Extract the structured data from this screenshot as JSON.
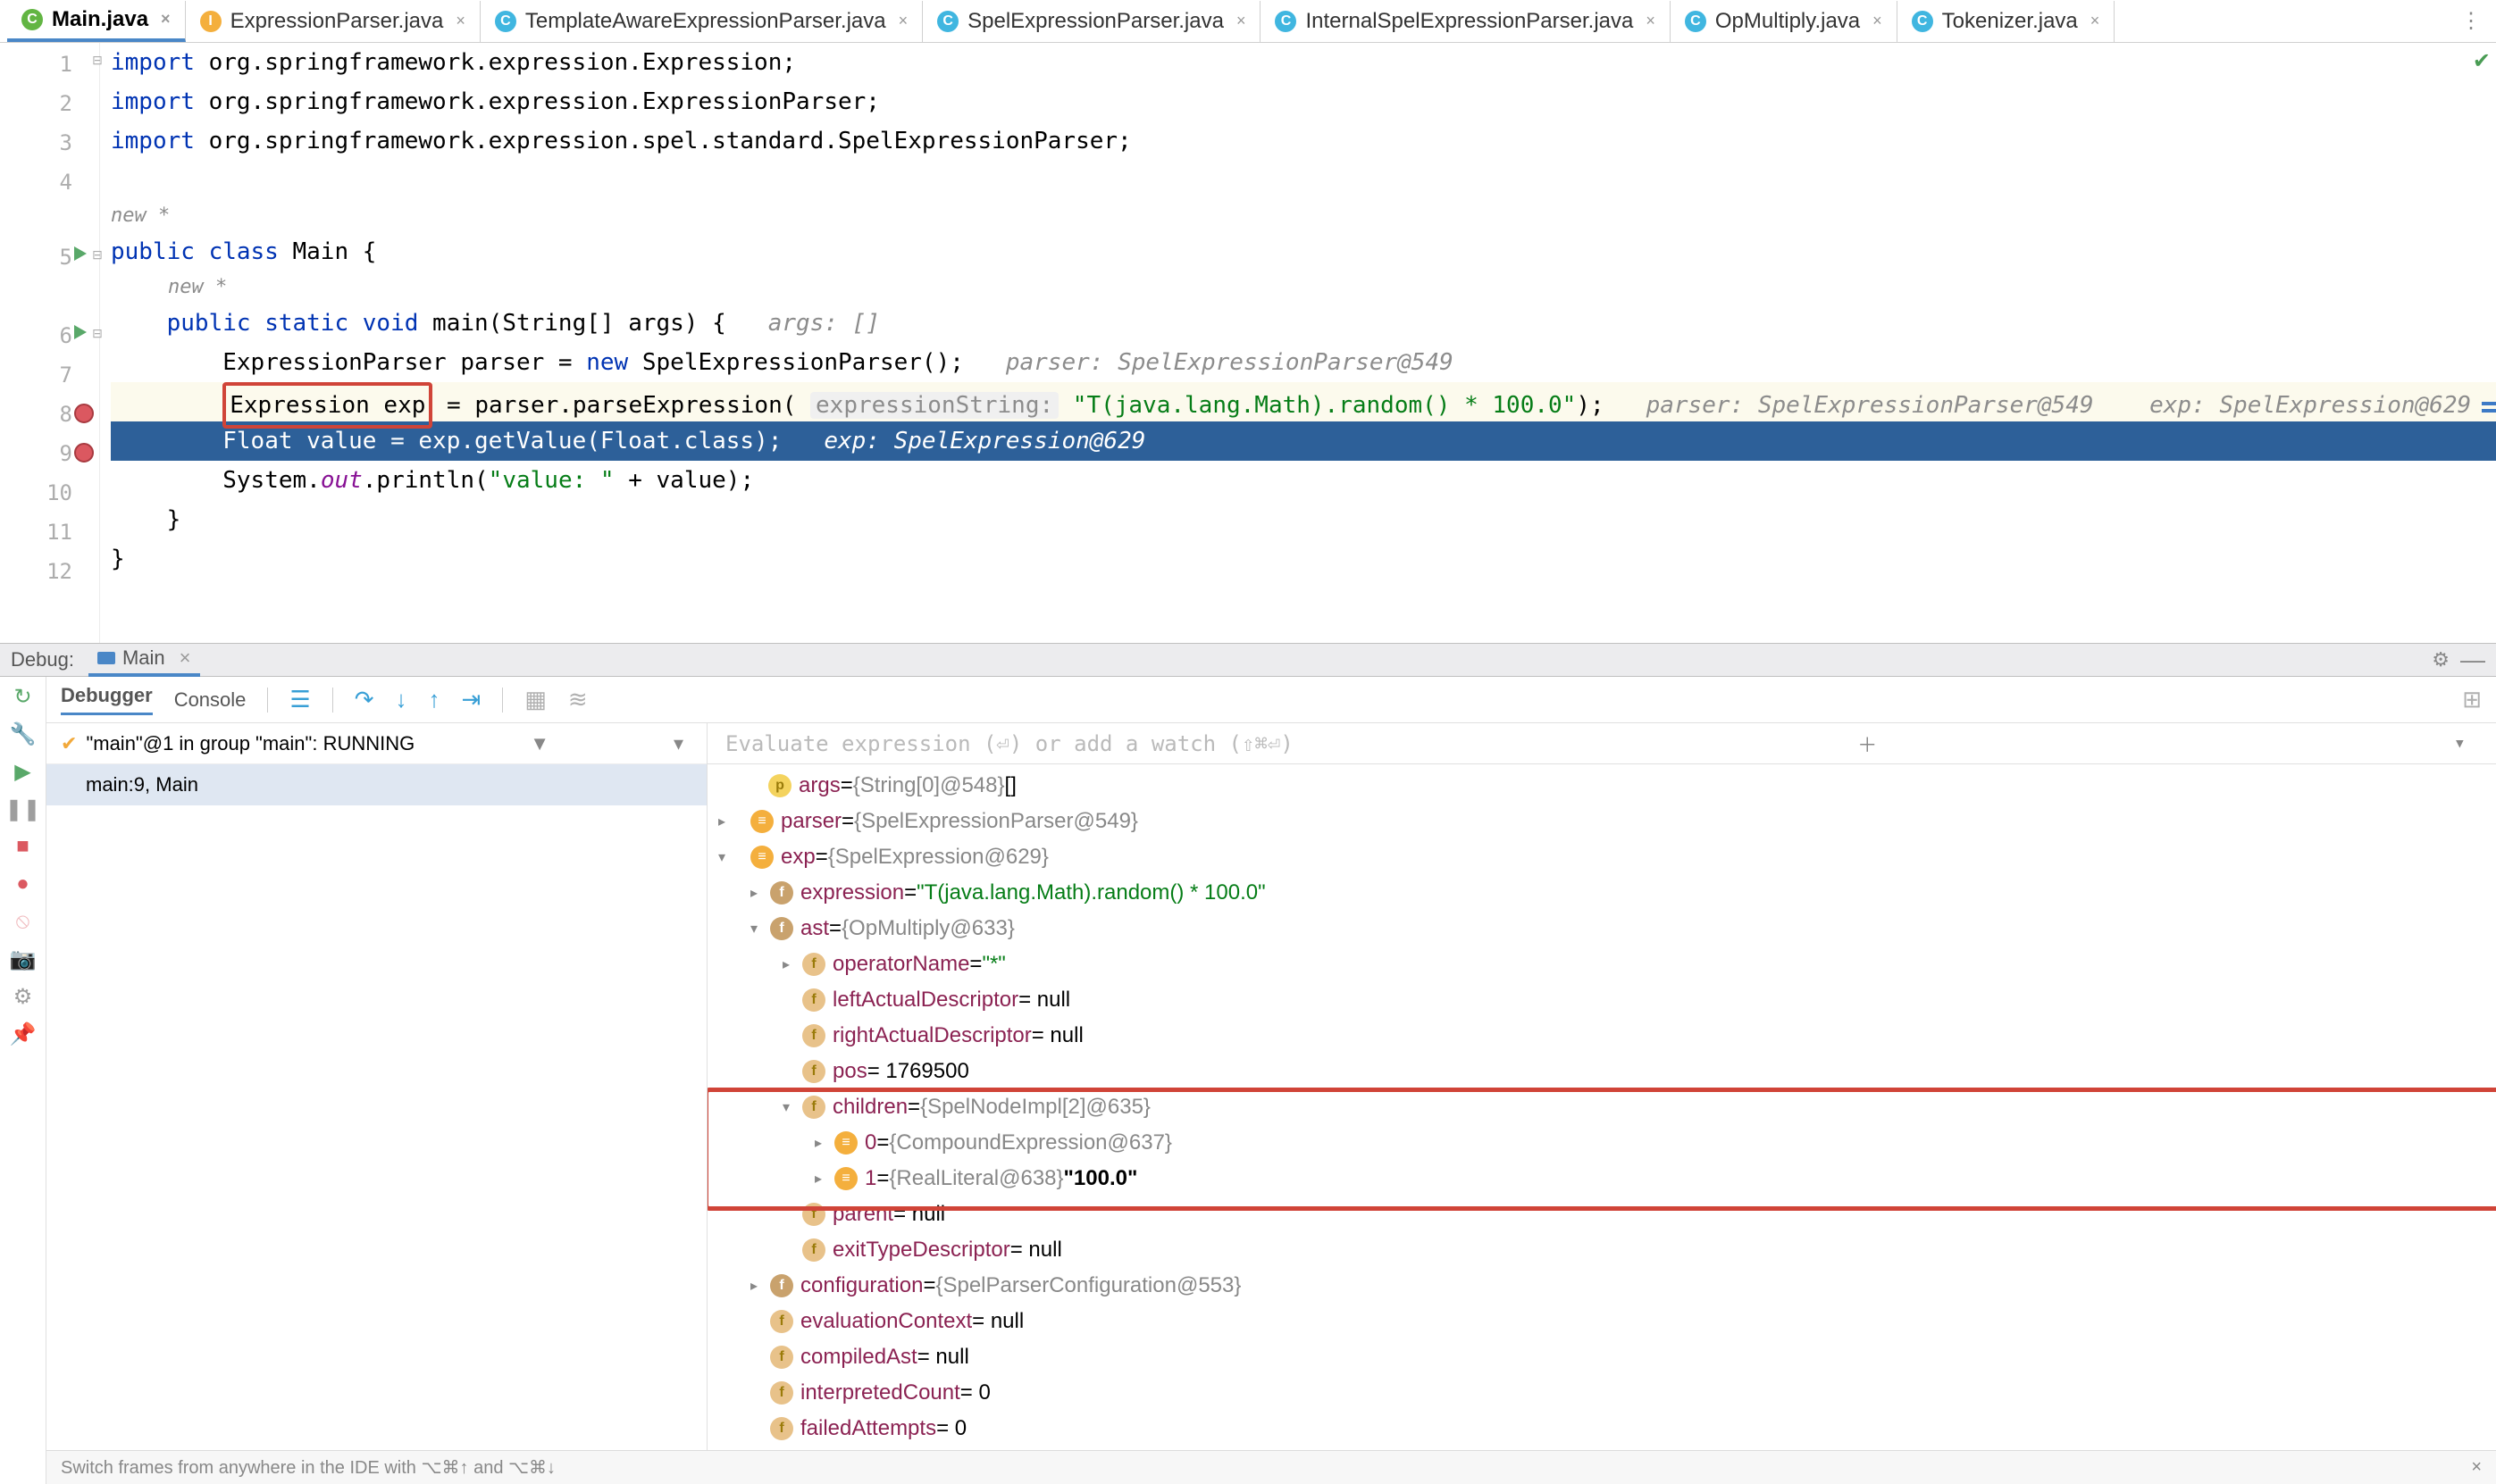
{
  "tabs": [
    {
      "label": "Main.java",
      "icon": "green",
      "active": true
    },
    {
      "label": "ExpressionParser.java",
      "icon": "yellow",
      "active": false
    },
    {
      "label": "TemplateAwareExpressionParser.java",
      "icon": "blue",
      "active": false
    },
    {
      "label": "SpelExpressionParser.java",
      "icon": "blue",
      "active": false
    },
    {
      "label": "InternalSpelExpressionParser.java",
      "icon": "blue",
      "active": false
    },
    {
      "label": "OpMultiply.java",
      "icon": "blue",
      "active": false
    },
    {
      "label": "Tokenizer.java",
      "icon": "blue",
      "active": false
    }
  ],
  "gutter_lines": [
    "1",
    "2",
    "3",
    "4",
    "5",
    "6",
    "7",
    "8",
    "9",
    "10",
    "11",
    "12"
  ],
  "code": {
    "l1a": "import",
    "l1b": " org.springframework.expression.Expression;",
    "l2a": "import",
    "l2b": " org.springframework.expression.ExpressionParser;",
    "l3a": "import",
    "l3b": " org.springframework.expression.spel.standard.SpelExpressionParser;",
    "l5h": "new *",
    "l5a": "public class ",
    "l5b": "Main {",
    "l6h": "new *",
    "l6a": "public static void ",
    "l6b": "main(String[] args) {",
    "l6c": "   args: []",
    "l7a": "ExpressionParser parser = ",
    "l7b": "new ",
    "l7c": "SpelExpressionParser();",
    "l7d": "   parser: SpelExpressionParser@549",
    "l8a": "Expression exp",
    "l8b": " = parser.parseExpression( ",
    "l8p": "expressionString:",
    "l8c": " \"T(java.lang.Math).random() * 100.0\"",
    "l8d": ");",
    "l8e": "   parser: SpelExpressionParser@549    exp: SpelExpression@629",
    "l9a": "Float value = exp.getValue(Float.",
    "l9b": "class",
    "l9c": ");",
    "l9d": "   exp: SpelExpression@629",
    "l10a": "System.",
    "l10b": "out",
    "l10c": ".println(",
    "l10d": "\"value: \"",
    "l10e": " + value);",
    "l11": "}",
    "l12": "}"
  },
  "debug": {
    "label": "Debug:",
    "run_name": "Main",
    "tabs": {
      "debugger": "Debugger",
      "console": "Console"
    },
    "thread": "\"main\"@1 in group \"main\": RUNNING",
    "frame": "main:9, Main",
    "eval": "Evaluate expression (⏎) or add a watch (⇧⌘⏎)"
  },
  "vars": {
    "args_n": "args",
    "args_eq": " = ",
    "args_g": "{String[0]@548}",
    "args_v": " []",
    "parser_n": "parser",
    "parser_eq": " = ",
    "parser_g": "{SpelExpressionParser@549}",
    "exp_n": "exp",
    "exp_eq": " = ",
    "exp_g": "{SpelExpression@629}",
    "expr_n": "expression",
    "expr_eq": " = ",
    "expr_v": "\"T(java.lang.Math).random() * 100.0\"",
    "ast_n": "ast",
    "ast_eq": " = ",
    "ast_g": "{OpMultiply@633}",
    "op_n": "operatorName",
    "op_eq": " = ",
    "op_v": "\"*\"",
    "la_n": "leftActualDescriptor",
    "la_v": " = null",
    "ra_n": "rightActualDescriptor",
    "ra_v": " = null",
    "pos_n": "pos",
    "pos_v": " = 1769500",
    "ch_n": "children",
    "ch_eq": " = ",
    "ch_g": "{SpelNodeImpl[2]@635}",
    "c0_n": "0",
    "c0_eq": " = ",
    "c0_g": "{CompoundExpression@637}",
    "c1_n": "1",
    "c1_eq": " = ",
    "c1_g": "{RealLiteral@638}",
    "c1_v": " \"100.0\"",
    "par_n": "parent",
    "par_v": " = null",
    "etd_n": "exitTypeDescriptor",
    "etd_v": " = null",
    "cfg_n": "configuration",
    "cfg_eq": " = ",
    "cfg_g": "{SpelParserConfiguration@553}",
    "ec_n": "evaluationContext",
    "ec_v": " = null",
    "ca_n": "compiledAst",
    "ca_v": " = null",
    "ic_n": "interpretedCount",
    "ic_v": " = 0",
    "fa_n": "failedAttempts",
    "fa_v": " = 0"
  },
  "status": "Switch frames from anywhere in the IDE with ⌥⌘↑ and ⌥⌘↓"
}
